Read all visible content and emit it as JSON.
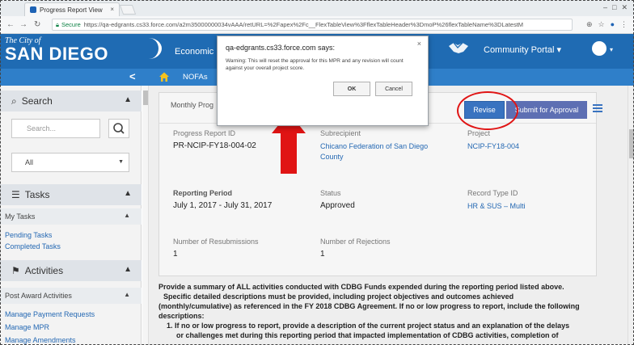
{
  "browser": {
    "tab_title": "Progress Report View",
    "tab_close": "×",
    "window_controls": [
      "–",
      "□",
      "✕"
    ],
    "secure_label": "Secure",
    "url": "https://qa-edgrants.cs33.force.com/a2m35000000034vAAA/retURL=%2Fapex%2Fc__FlexTableView%3FflexTableHeader%3DmoP%26flexTableName%3DLatestM"
  },
  "header": {
    "city_line": "The City of",
    "city_name": "SAN DIEGO",
    "title": "Economic",
    "portal_label": "Community Portal ▾",
    "avatar_caret": "▾",
    "brand_color": "#1f6bb3"
  },
  "subnav": {
    "collapse_label": "<",
    "nofas_label": "NOFAs"
  },
  "sidebar": {
    "search_heading": "Search",
    "search_placeholder": "Search...",
    "filter_value": "All",
    "tasks_heading": "Tasks",
    "my_tasks": "My Tasks",
    "task_links": [
      "Pending Tasks",
      "Completed Tasks"
    ],
    "activities_heading": "Activities",
    "post_award": "Post Award Activities",
    "activity_links": [
      "Manage Payment Requests",
      "Manage MPR",
      "Manage Amendments"
    ]
  },
  "record": {
    "card_title": "Monthly Prog",
    "revise_label": "Revise",
    "submit_label": "Submit for Approval",
    "fields": {
      "progress_report_id_label": "Progress Report ID",
      "progress_report_id": "PR-NCIP-FY18-004-02",
      "subrecipient_label": "Subrecipient",
      "subrecipient": "Chicano Federation of San Diego County",
      "project_label": "Project",
      "project": "NCIP-FY18-004",
      "reporting_period_label": "Reporting Period",
      "reporting_period": "July 1, 2017 - July 31, 2017",
      "status_label": "Status",
      "status": "Approved",
      "record_type_label": "Record Type ID",
      "record_type": "HR & SUS – Multi",
      "resubmissions_label": "Number of Resubmissions",
      "resubmissions": "1",
      "rejections_label": "Number of Rejections",
      "rejections": "1"
    }
  },
  "summary": {
    "line1": "Provide a summary of ALL activities conducted with CDBG Funds expended during the reporting period listed above.",
    "line2": "Specific detailed descriptions must be provided, including project objectives and outcomes achieved",
    "line3": "(monthly/cumulative) as referenced in the FY 2018 CDBG Agreement. If no or low progress to report, include the following",
    "line4": "descriptions:",
    "item1a": "1. If no or low progress to report, provide a description of the current project status and an explanation of the delays",
    "item1b": "or challenges met during this reporting period that impacted implementation of CDBG activities, completion of"
  },
  "dialog": {
    "title": "qa-edgrants.cs33.force.com says:",
    "close": "×",
    "message": "Warning: This will reset the approval for this MPR and any revision will count against your overall project score.",
    "ok_label": "OK",
    "cancel_label": "Cancel"
  },
  "annotation_color": "#e01414"
}
